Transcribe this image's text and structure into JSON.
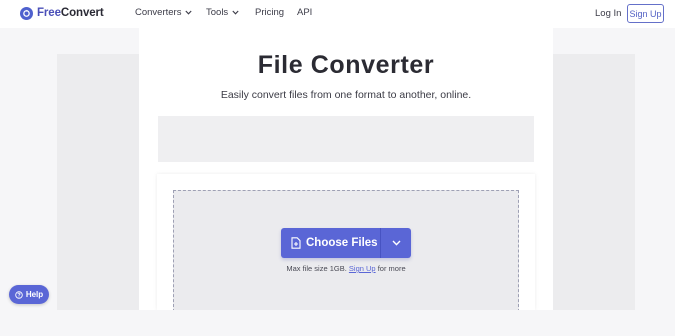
{
  "brand": {
    "name_part1": "Free",
    "name_part2": "Convert",
    "accent": "#5a66d6"
  },
  "nav": {
    "converters": "Converters",
    "tools": "Tools",
    "pricing": "Pricing",
    "api": "API"
  },
  "auth": {
    "login": "Log In",
    "signup": "Sign Up"
  },
  "hero": {
    "title": "File Converter",
    "subtitle": "Easily convert files from one format to another, online."
  },
  "upload": {
    "choose_label": "Choose Files",
    "max_prefix": "Max file size 1GB.",
    "signup_link": "Sign Up",
    "max_suffix": "for more"
  },
  "help": {
    "label": "Help"
  },
  "icons": {
    "logo": "refresh-circle-icon",
    "dropdown": "chevron-down-icon",
    "file": "file-add-icon",
    "help": "help-circle-icon"
  }
}
